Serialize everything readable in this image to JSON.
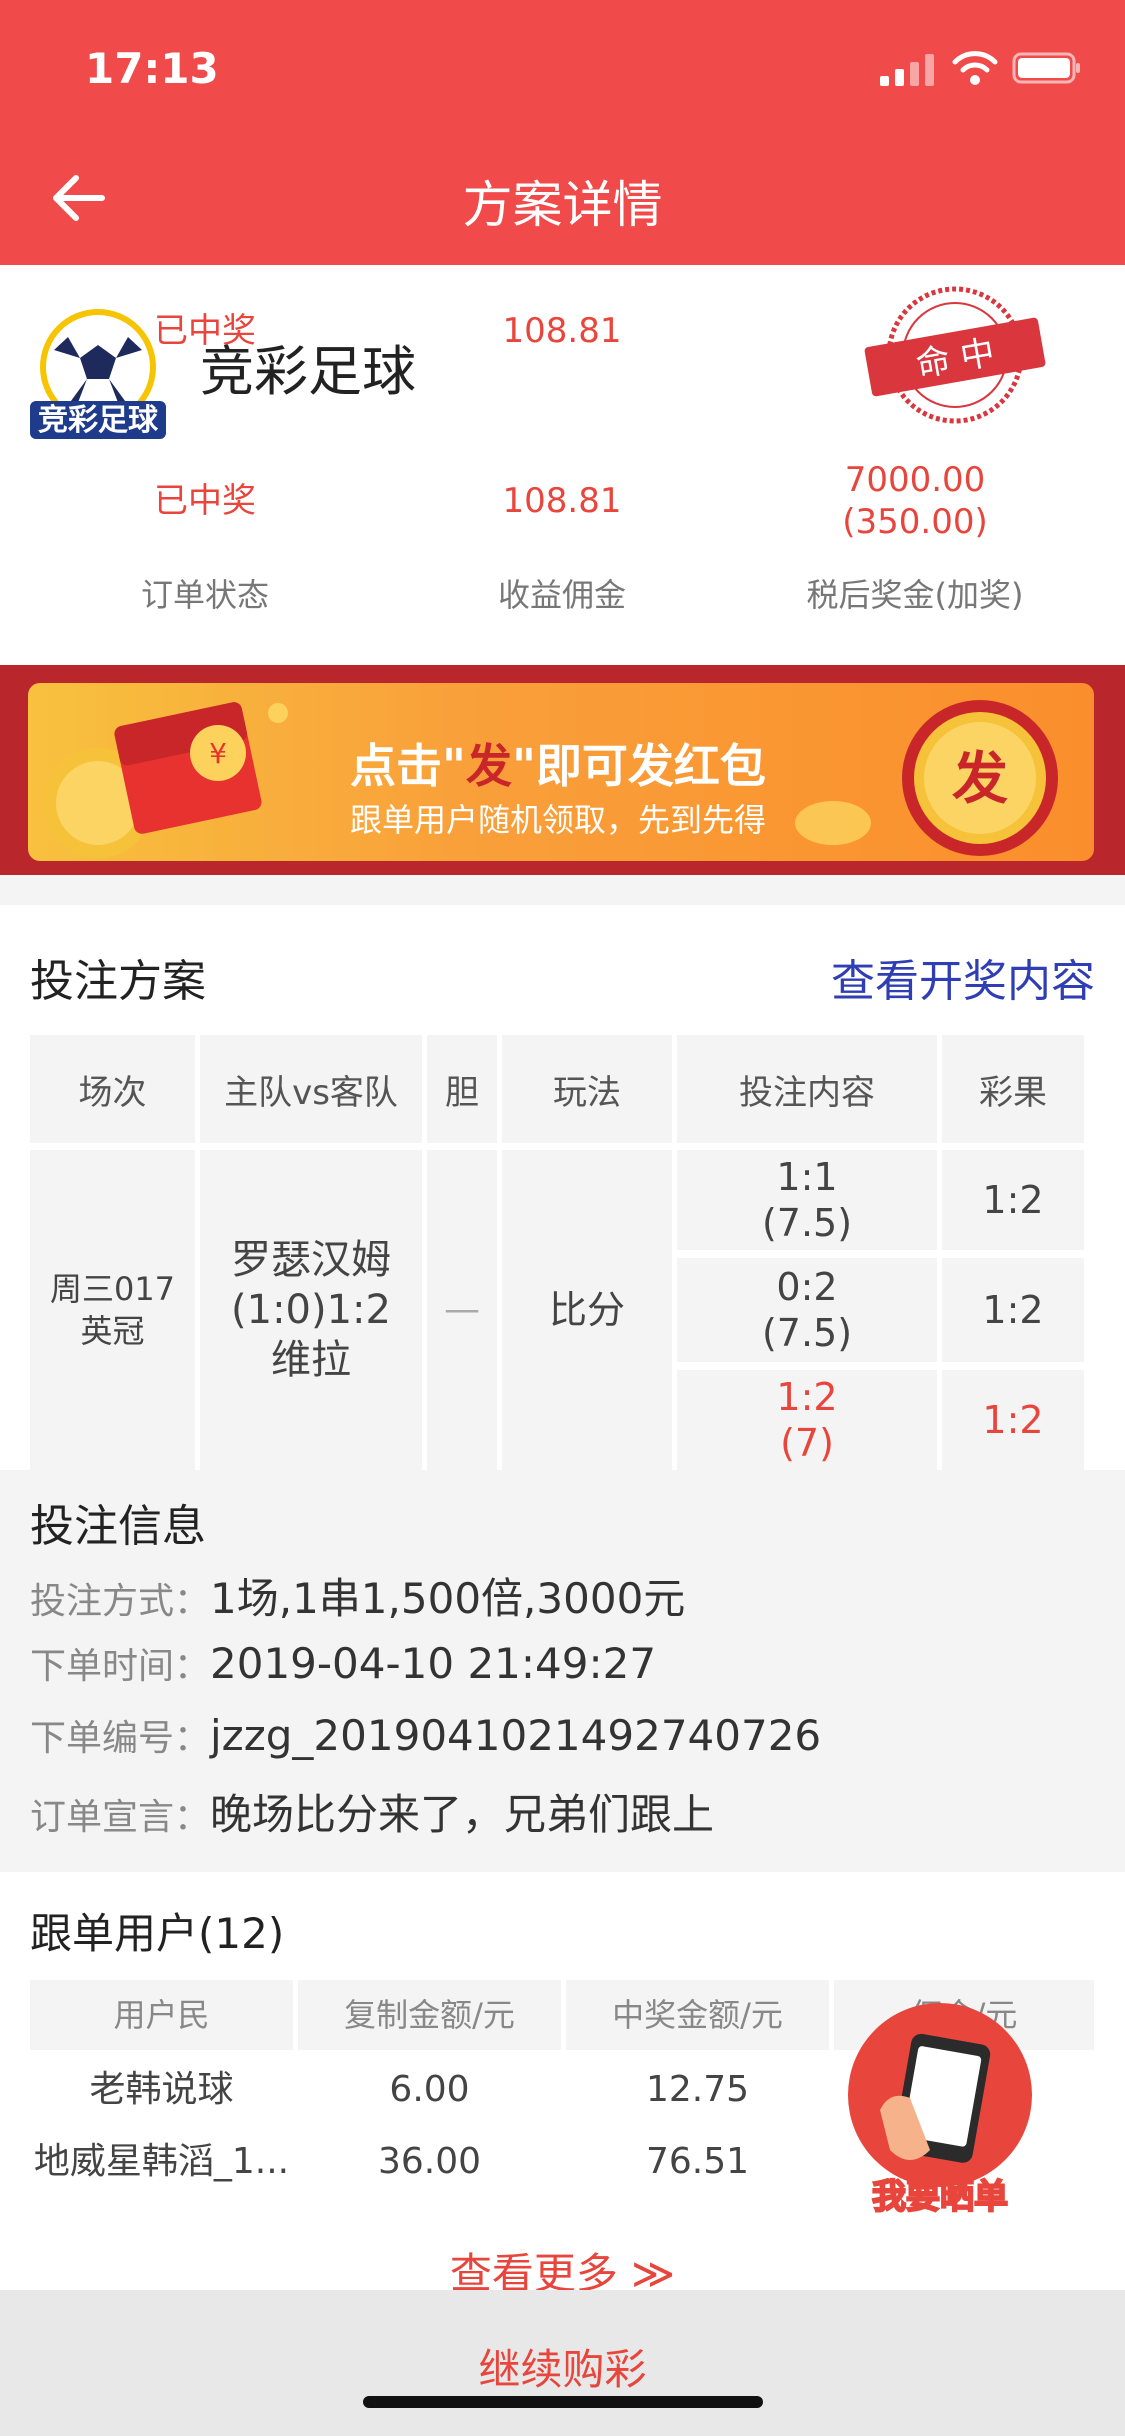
{
  "status_bar": {
    "time": "17:13"
  },
  "header": {
    "title": "方案详情"
  },
  "summary": {
    "game_name": "竞彩足球",
    "logo_text": "竞彩足球",
    "stamp_text": "命 中",
    "stats": [
      {
        "value": "已中奖",
        "label": "订单状态"
      },
      {
        "value": "108.81",
        "label": "收益佣金"
      },
      {
        "value": "7000.00",
        "value2": "(350.00)",
        "label": "税后奖金(加奖)"
      }
    ]
  },
  "banner": {
    "title_pre": "点击\"",
    "title_em": "发",
    "title_post": "\"即可发红包",
    "subtitle": "跟单用户随机领取，先到先得",
    "button": "发"
  },
  "plan": {
    "title": "投注方案",
    "link": "查看开奖内容",
    "headers": [
      "场次",
      "主队vs客队",
      "胆",
      "玩法",
      "投注内容",
      "彩果"
    ],
    "match": {
      "line1": "周三017",
      "line2": "英冠"
    },
    "teams": {
      "line1": "罗瑟汉姆",
      "line2": "(1:0)1:2",
      "line3": "维拉"
    },
    "dan": "—",
    "play": "比分",
    "bets": [
      {
        "score": "1:1",
        "odds": "(7.5)",
        "result": "1:2"
      },
      {
        "score": "0:2",
        "odds": "(7.5)",
        "result": "1:2"
      },
      {
        "score": "1:2",
        "odds": "(7)",
        "result": "1:2"
      }
    ]
  },
  "info": {
    "title": "投注信息",
    "rows": [
      {
        "label": "投注方式：",
        "value": "1场,1串1,500倍,3000元"
      },
      {
        "label": "下单时间：",
        "value": "2019-04-10 21:49:27"
      },
      {
        "label": "下单编号：",
        "value": "jzzg_2019041021492740726"
      },
      {
        "label": "订单宣言：",
        "value": "晚场比分来了，兄弟们跟上"
      }
    ]
  },
  "followers": {
    "title": "跟单用户(12)",
    "headers": [
      "用户民",
      "复制金额/元",
      "中奖金额/元",
      "佣金/元"
    ],
    "rows": [
      {
        "user": "老韩说球",
        "copy": "6.00",
        "win": "12.75"
      },
      {
        "user": "地威星韩滔_1...",
        "copy": "36.00",
        "win": "76.51"
      }
    ],
    "more": "查看更多 ≫",
    "show_button": "我要晒单"
  },
  "bottom": {
    "continue": "继续购彩"
  },
  "colors": {
    "brand_red": "#f04a4a",
    "accent_red": "#e8453c",
    "link_blue": "#2f3fb3"
  }
}
